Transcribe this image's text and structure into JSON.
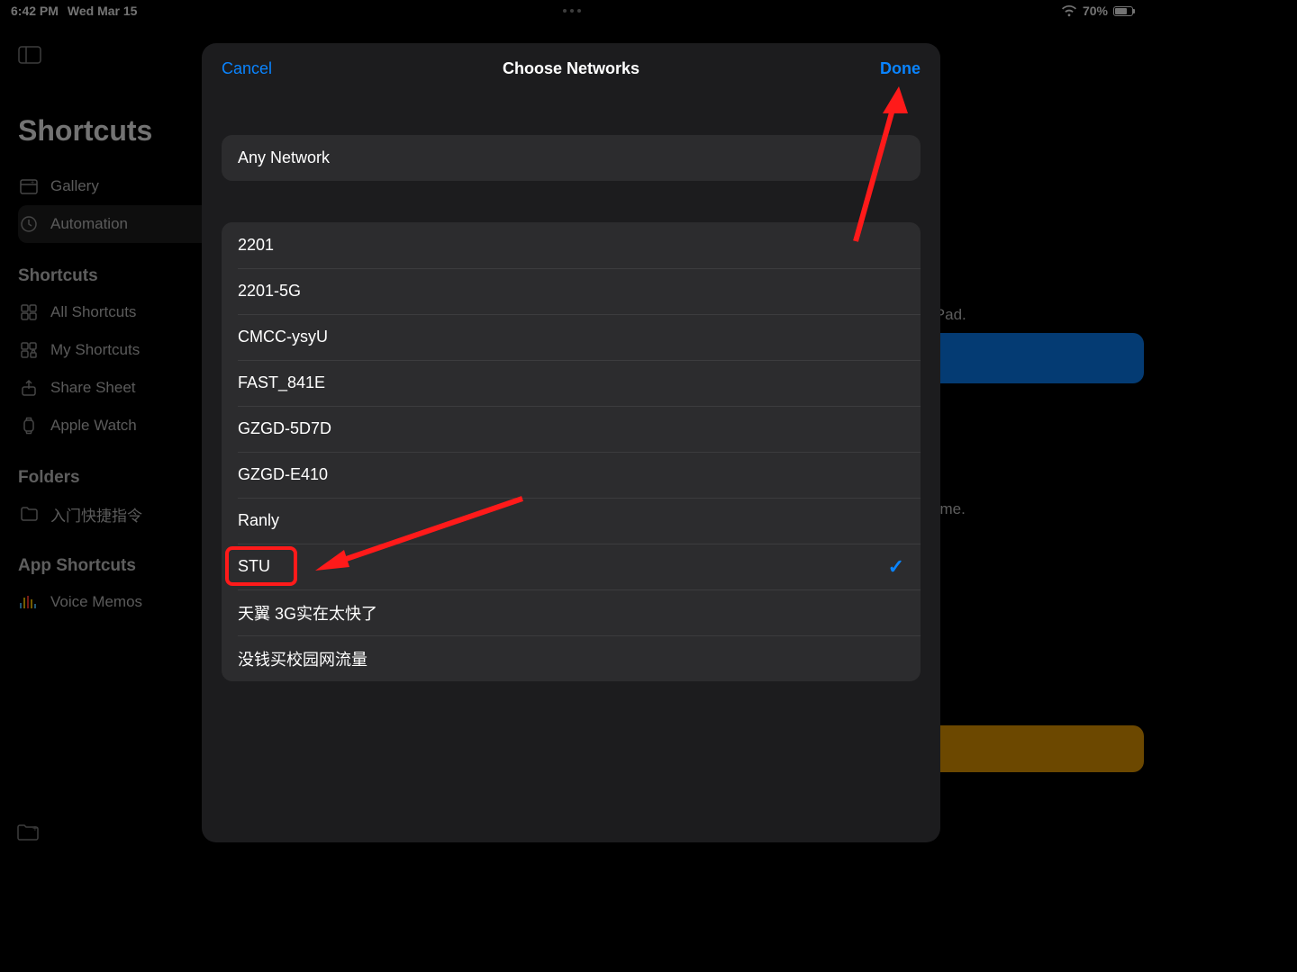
{
  "status": {
    "time": "6:42 PM",
    "date": "Wed Mar 15",
    "battery": "70%"
  },
  "sidebar": {
    "title": "Shortcuts",
    "top": [
      {
        "icon": "gallery",
        "label": "Gallery"
      },
      {
        "icon": "clock",
        "label": "Automation",
        "selected": true
      }
    ],
    "shortcuts_header": "Shortcuts",
    "shortcuts": [
      {
        "icon": "grid",
        "label": "All Shortcuts"
      },
      {
        "icon": "grid-lock",
        "label": "My Shortcuts"
      },
      {
        "icon": "share",
        "label": "Share Sheet"
      },
      {
        "icon": "watch",
        "label": "Apple Watch"
      }
    ],
    "folders_header": "Folders",
    "folders": [
      {
        "icon": "folder",
        "label": "入门快捷指令"
      }
    ],
    "app_header": "App Shortcuts",
    "apps": [
      {
        "icon": "voice",
        "label": "Voice Memos"
      }
    ]
  },
  "background": {
    "text1": "iPad.",
    "text2": "ome."
  },
  "modal": {
    "cancel": "Cancel",
    "title": "Choose Networks",
    "done": "Done",
    "any": "Any Network",
    "networks": [
      {
        "name": "2201",
        "selected": false
      },
      {
        "name": "2201-5G",
        "selected": false
      },
      {
        "name": "CMCC-ysyU",
        "selected": false
      },
      {
        "name": "FAST_841E",
        "selected": false
      },
      {
        "name": "GZGD-5D7D",
        "selected": false
      },
      {
        "name": "GZGD-E410",
        "selected": false
      },
      {
        "name": "Ranly",
        "selected": false
      },
      {
        "name": "STU",
        "selected": true
      },
      {
        "name": "天翼 3G实在太快了",
        "selected": false
      },
      {
        "name": "没钱买校园网流量",
        "selected": false
      }
    ]
  },
  "annotation": {
    "highlight_index": 7
  }
}
